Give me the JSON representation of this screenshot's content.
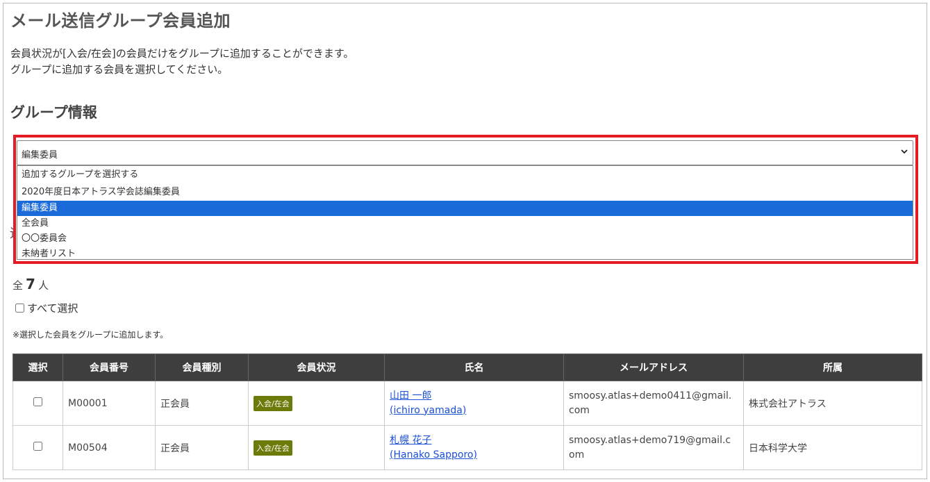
{
  "page": {
    "title": "メール送信グループ会員追加",
    "intro_line1": "会員状況が[入会/在会]の会員だけをグループに追加することができます。",
    "intro_line2": "グループに追加する会員を選択してください。"
  },
  "group_info": {
    "title": "グループ情報",
    "selected_value": "編集委員",
    "options": [
      "追加するグループを選択する",
      "2020年度日本アトラス学会誌編集委員",
      "編集委員",
      "全会員",
      "〇〇委員会",
      "未納者リスト"
    ],
    "hidden_stub": "追"
  },
  "members": {
    "count_prefix": "全",
    "count": "7",
    "count_suffix": "人",
    "select_all_label": "すべて選択",
    "note": "※選択した会員をグループに追加します。",
    "columns": [
      "選択",
      "会員番号",
      "会員種別",
      "会員状況",
      "氏名",
      "メールアドレス",
      "所属"
    ],
    "rows": [
      {
        "id": "M00001",
        "type": "正会員",
        "status": "入会/在会",
        "name": "山田 一郎",
        "name_en": "(ichiro yamada)",
        "email_line1": "smoosy.atlas+demo0411@gmail.",
        "email_line2": "com",
        "affiliation": "株式会社アトラス"
      },
      {
        "id": "M00504",
        "type": "正会員",
        "status": "入会/在会",
        "name": "札幌 花子",
        "name_en": "(Hanako Sapporo)",
        "email_line1": "smoosy.atlas+demo719@gmail.c",
        "email_line2": "om",
        "affiliation": "日本科学大学"
      }
    ]
  },
  "colors": {
    "highlight": "#e51b24",
    "selected_option": "#1a6ad9",
    "header_bg": "#3e3e3e",
    "badge": "#6b7a08",
    "link": "#1a4fd6"
  }
}
